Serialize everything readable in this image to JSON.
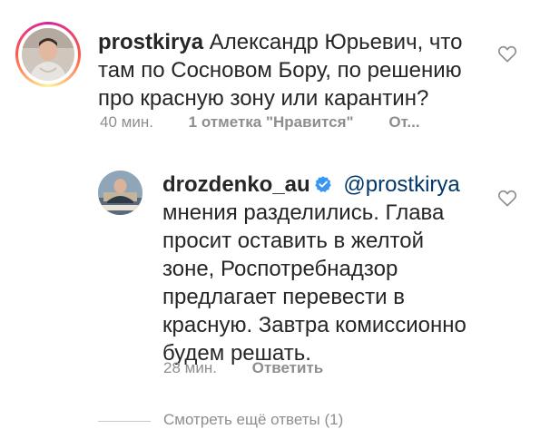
{
  "comment": {
    "username": "prostkirya",
    "lines": [
      "Александр Юрьевич, что",
      "там по Сосновом Бору, по решению",
      "про красную зону или карантин?"
    ],
    "time": "40 мин.",
    "likes": "1 отметка \"Нравится\"",
    "reply_label": "От..."
  },
  "reply": {
    "username": "drozdenko_au",
    "mention": "@prostkirya",
    "lines": [
      "мнения разделились. Глава",
      "просит оставить в желтой",
      "зоне, Роспотребнадзор",
      "предлагает перевести в",
      "красную. Завтра комиссионно",
      "будем решать."
    ],
    "time": "28 мин.",
    "reply_label": "Ответить"
  },
  "view_replies": "Смотреть ещё ответы (1)",
  "colors": {
    "text": "#262626",
    "muted": "#8e8e8e",
    "verified": "#3897f0",
    "mention": "#00376b"
  },
  "icons": {
    "like": "heart-outline-icon",
    "verified": "verified-badge-icon"
  }
}
